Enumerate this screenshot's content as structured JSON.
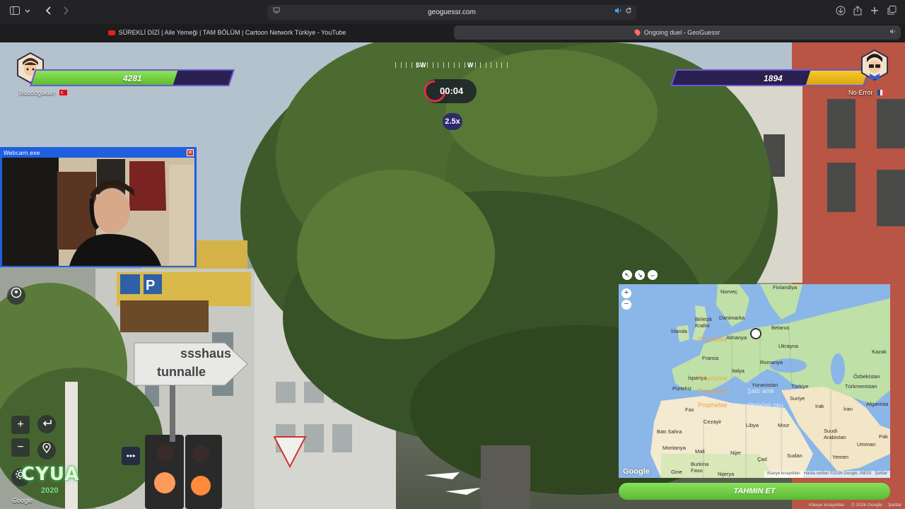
{
  "browser": {
    "url": "geoguessr.com",
    "tabs": [
      {
        "label": "SÜREKLİ DİZİ | Aile Yemeği | TAM BÖLÜM | Cartoon Network Türkiye - YouTube",
        "active": false
      },
      {
        "label": "Ongoing duel - GeoGuessr",
        "active": true
      }
    ],
    "icons": [
      "sidebar-icon",
      "chevron-down-icon",
      "back-icon",
      "forward-icon",
      "reader-icon",
      "audio-icon",
      "reload-icon",
      "download-icon",
      "share-icon",
      "new-tab-icon",
      "tab-overview-icon"
    ]
  },
  "duel": {
    "player1": {
      "name": "Buodogukan",
      "health": 4281,
      "health_fraction": 0.72,
      "flag": "tr"
    },
    "player2": {
      "name": "No-Error",
      "health": 1894,
      "health_fraction": 0.3,
      "flag": "fr"
    },
    "timer": "00:04",
    "multiplier": "2.5x",
    "compass": [
      "SW",
      "W"
    ]
  },
  "webcam": {
    "title": "Webcam.exe"
  },
  "street_signs": [
    "ssshaus",
    "tunnalle"
  ],
  "controls": {
    "zoom_in": "+",
    "zoom_out": "−"
  },
  "branding": {
    "logo": "CYUA",
    "year": "2020",
    "google": "Google"
  },
  "map": {
    "labels": {
      "finlandiya": "Finlandiya",
      "norvec": "Norveç",
      "danimarka": "Danimarka",
      "birlesik": "Birleşik Krallık",
      "irlanda": "İrlanda",
      "belarus": "Belarus",
      "almanya": "Almanya",
      "ukrayna": "Ukrayna",
      "fransa": "Fransa",
      "italya": "İtalya",
      "ispanya": "İspanya",
      "portekiz": "Portekiz",
      "romanya": "Romanya",
      "yunanistan": "Yunanistan",
      "turkiye": "Türkiye",
      "kazak": "Kazak",
      "ozbekistan": "Özbekistan",
      "turkmenistan": "Türkmenistan",
      "suriye": "Suriye",
      "irak": "Irak",
      "iran": "İran",
      "afganistan": "Afganista",
      "fas": "Fas",
      "cezayir": "Cezayir",
      "libya": "Libya",
      "misir": "Mısır",
      "suudi": "Suudi Arabistan",
      "umman": "Umman",
      "pak": "Pak",
      "bati_sahra": "Batı Sahra",
      "moritanya": "Moritanya",
      "mali": "Mali",
      "nijer": "Nijer",
      "cad": "Çad",
      "sudan": "Sudan",
      "yemen": "Yemen",
      "burkina": "Burkina Faso",
      "nijerya": "Nijerya",
      "gine": "Gine"
    },
    "overlays": [
      {
        "text": "Prophetee",
        "color": "#f0a040"
      },
      {
        "text": "Prophetee",
        "color": "#f0a040"
      },
      {
        "text": "Prophetee",
        "color": "#f0a040"
      },
      {
        "text": "Prophetee",
        "color": "#f0a040"
      },
      {
        "text": "Şato amk",
        "color": "#e6e6ff"
      },
      {
        "text": "Otobüsü oku",
        "color": "#e6e6ff"
      }
    ],
    "footer": {
      "shortcuts": "Klavye kısayolları",
      "data": "Harita verileri ©2026 Google, INEGI",
      "terms": "Şartlar"
    },
    "google": "Google",
    "guess_button": "TAHMIN ET"
  },
  "bottom_bar": {
    "shortcuts": "Klavye kısayolları",
    "copyright": "© 2026 Google",
    "terms": "Şartlar"
  }
}
